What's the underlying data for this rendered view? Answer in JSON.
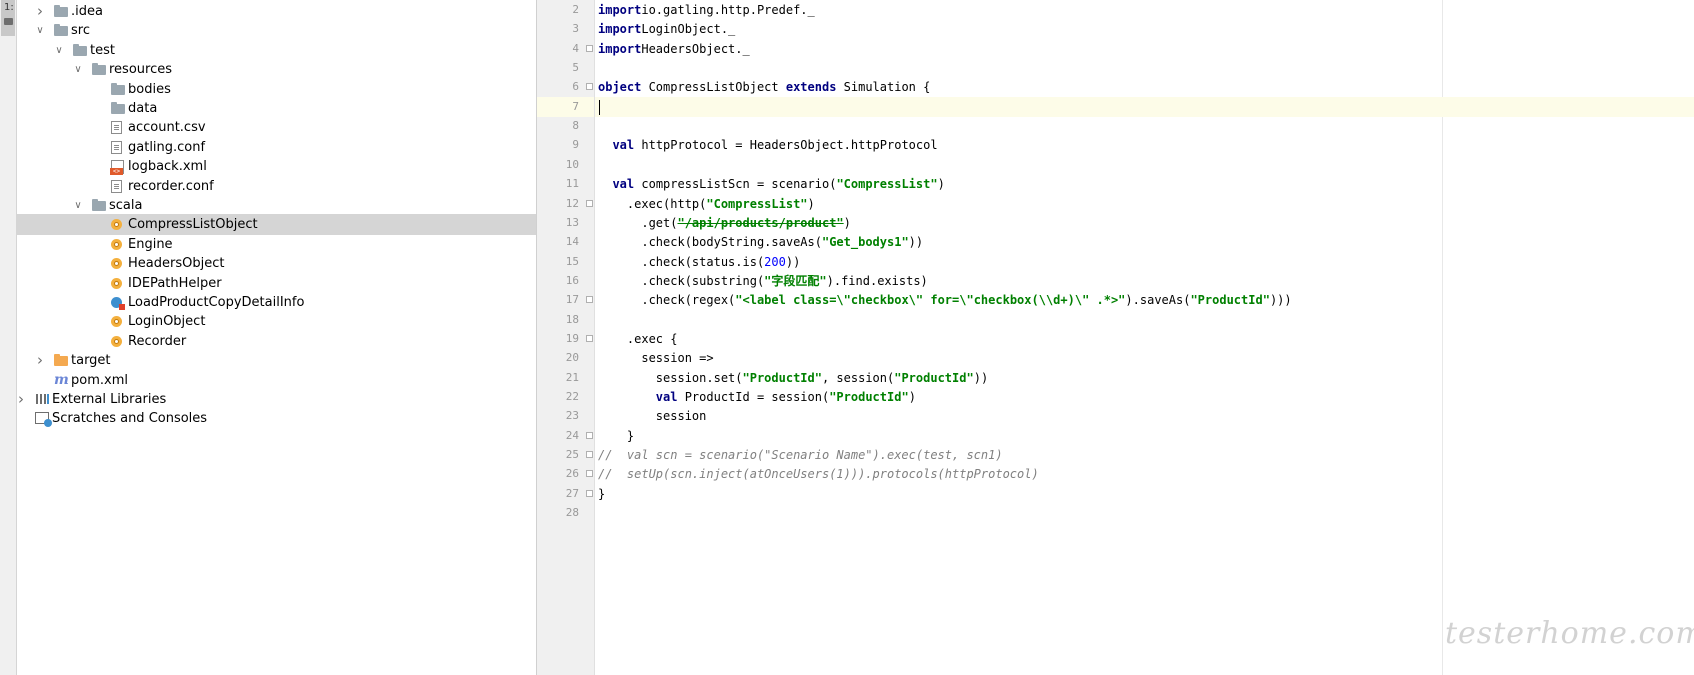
{
  "tool_strip": {
    "project_tab_label": "1:"
  },
  "tree": [
    {
      "indent": 0,
      "arrow": "right",
      "icon": "folder",
      "label": ".idea"
    },
    {
      "indent": 0,
      "arrow": "down",
      "icon": "folder",
      "label": "src"
    },
    {
      "indent": 1,
      "arrow": "down",
      "icon": "folder",
      "label": "test"
    },
    {
      "indent": 2,
      "arrow": "down",
      "icon": "folder",
      "label": "resources"
    },
    {
      "indent": 3,
      "arrow": "",
      "icon": "folder",
      "label": "bodies"
    },
    {
      "indent": 3,
      "arrow": "",
      "icon": "folder",
      "label": "data"
    },
    {
      "indent": 3,
      "arrow": "",
      "icon": "file",
      "label": "account.csv"
    },
    {
      "indent": 3,
      "arrow": "",
      "icon": "file",
      "label": "gatling.conf"
    },
    {
      "indent": 3,
      "arrow": "",
      "icon": "xml",
      "label": "logback.xml"
    },
    {
      "indent": 3,
      "arrow": "",
      "icon": "file",
      "label": "recorder.conf"
    },
    {
      "indent": 2,
      "arrow": "down",
      "icon": "folder",
      "label": "scala"
    },
    {
      "indent": 3,
      "arrow": "",
      "icon": "object",
      "label": "CompressListObject",
      "selected": true
    },
    {
      "indent": 3,
      "arrow": "",
      "icon": "object",
      "label": "Engine"
    },
    {
      "indent": 3,
      "arrow": "",
      "icon": "object",
      "label": "HeadersObject"
    },
    {
      "indent": 3,
      "arrow": "",
      "icon": "object",
      "label": "IDEPathHelper"
    },
    {
      "indent": 3,
      "arrow": "",
      "icon": "class",
      "label": "LoadProductCopyDetailInfo"
    },
    {
      "indent": 3,
      "arrow": "",
      "icon": "object",
      "label": "LoginObject"
    },
    {
      "indent": 3,
      "arrow": "",
      "icon": "object",
      "label": "Recorder"
    },
    {
      "indent": 0,
      "arrow": "right",
      "icon": "folder-orange",
      "label": "target"
    },
    {
      "indent": 0,
      "arrow": "",
      "icon": "maven",
      "label": "pom.xml"
    },
    {
      "indent": -1,
      "arrow": "right",
      "icon": "libs",
      "label": "External Libraries"
    },
    {
      "indent": -1,
      "arrow": "",
      "icon": "scratch",
      "label": "Scratches and Consoles"
    }
  ],
  "editor": {
    "current_line": 7,
    "lines": [
      {
        "n": 2,
        "fold": false,
        "tokens": [
          [
            "kw",
            "import"
          ],
          [
            "",
            "io.gatling.http.Predef._"
          ]
        ]
      },
      {
        "n": 3,
        "fold": false,
        "tokens": [
          [
            "kw",
            "import"
          ],
          [
            "",
            "LoginObject._"
          ]
        ]
      },
      {
        "n": 4,
        "fold": true,
        "tokens": [
          [
            "kw",
            "import"
          ],
          [
            "",
            "HeadersObject._"
          ]
        ]
      },
      {
        "n": 5,
        "fold": false,
        "tokens": []
      },
      {
        "n": 6,
        "fold": true,
        "tokens": [
          [
            "kw",
            "object"
          ],
          [
            "",
            " CompressListObject "
          ],
          [
            "kw",
            "extends"
          ],
          [
            "",
            " Simulation {"
          ]
        ]
      },
      {
        "n": 7,
        "fold": false,
        "tokens": []
      },
      {
        "n": 8,
        "fold": false,
        "tokens": []
      },
      {
        "n": 9,
        "fold": false,
        "tokens": [
          [
            "",
            "  "
          ],
          [
            "kw",
            "val"
          ],
          [
            "",
            " httpProtocol = HeadersObject.httpProtocol"
          ]
        ]
      },
      {
        "n": 10,
        "fold": false,
        "tokens": []
      },
      {
        "n": 11,
        "fold": false,
        "tokens": [
          [
            "",
            "  "
          ],
          [
            "kw",
            "val"
          ],
          [
            "",
            " compressListScn = scenario("
          ],
          [
            "str",
            "\"CompressList\""
          ],
          [
            "",
            ")"
          ]
        ]
      },
      {
        "n": 12,
        "fold": true,
        "tokens": [
          [
            "",
            "    .exec(http("
          ],
          [
            "str",
            "\"CompressList\""
          ],
          [
            "",
            ")"
          ]
        ]
      },
      {
        "n": 13,
        "fold": false,
        "tokens": [
          [
            "",
            "      .get("
          ],
          [
            "strike",
            "\"/api/products/product\""
          ],
          [
            "",
            ")"
          ]
        ]
      },
      {
        "n": 14,
        "fold": false,
        "tokens": [
          [
            "",
            "      .check(bodyString.saveAs("
          ],
          [
            "str",
            "\"Get_bodys1\""
          ],
          [
            "",
            "))"
          ]
        ]
      },
      {
        "n": 15,
        "fold": false,
        "tokens": [
          [
            "",
            "      .check(status.is("
          ],
          [
            "num",
            "200"
          ],
          [
            "",
            "))"
          ]
        ]
      },
      {
        "n": 16,
        "fold": false,
        "tokens": [
          [
            "",
            "      .check(substring("
          ],
          [
            "str",
            "\"字段匹配\""
          ],
          [
            "",
            ").find.exists)"
          ]
        ]
      },
      {
        "n": 17,
        "fold": true,
        "tokens": [
          [
            "",
            "      .check(regex("
          ],
          [
            "str",
            "\"<label class=\\\"checkbox\\\" for=\\\"checkbox(\\\\d+)\\\" .*>\""
          ],
          [
            "",
            ").saveAs("
          ],
          [
            "str",
            "\"ProductId\""
          ],
          [
            "",
            ")))"
          ]
        ]
      },
      {
        "n": 18,
        "fold": false,
        "tokens": []
      },
      {
        "n": 19,
        "fold": true,
        "tokens": [
          [
            "",
            "    .exec {"
          ]
        ]
      },
      {
        "n": 20,
        "fold": false,
        "tokens": [
          [
            "",
            "      session =>"
          ]
        ]
      },
      {
        "n": 21,
        "fold": false,
        "tokens": [
          [
            "",
            "        session.set("
          ],
          [
            "str",
            "\"ProductId\""
          ],
          [
            "",
            ", session("
          ],
          [
            "str",
            "\"ProductId\""
          ],
          [
            "",
            "))"
          ]
        ]
      },
      {
        "n": 22,
        "fold": false,
        "tokens": [
          [
            "",
            "        "
          ],
          [
            "kw",
            "val"
          ],
          [
            "",
            " ProductId = session("
          ],
          [
            "str",
            "\"ProductId\""
          ],
          [
            "",
            ")"
          ]
        ]
      },
      {
        "n": 23,
        "fold": false,
        "tokens": [
          [
            "",
            "        session"
          ]
        ]
      },
      {
        "n": 24,
        "fold": true,
        "tokens": [
          [
            "",
            "    }"
          ]
        ]
      },
      {
        "n": 25,
        "fold": true,
        "tokens": [
          [
            "cmt",
            "//  val scn = scenario(\"Scenario Name\").exec(test, scn1)"
          ]
        ]
      },
      {
        "n": 26,
        "fold": true,
        "tokens": [
          [
            "cmt",
            "//  setUp(scn.inject(atOnceUsers(1))).protocols(httpProtocol)"
          ]
        ]
      },
      {
        "n": 27,
        "fold": true,
        "tokens": [
          [
            "",
            "}"
          ]
        ]
      },
      {
        "n": 28,
        "fold": false,
        "tokens": []
      }
    ]
  },
  "watermark": "testerhome.com"
}
